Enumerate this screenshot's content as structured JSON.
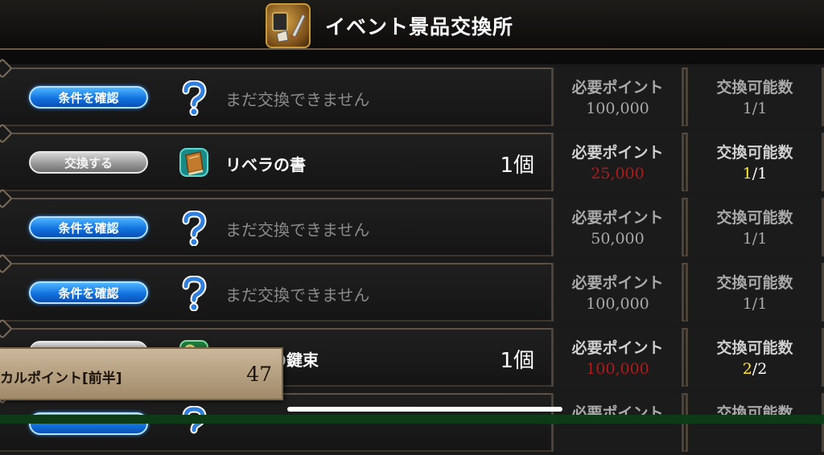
{
  "header": {
    "title": "イベント景品交換所",
    "emblem_icon": "sword-shield-emblem-icon"
  },
  "columns": {
    "points_label": "必要ポイント",
    "count_label": "交換可能数"
  },
  "rows": [
    {
      "button_label": "条件を確認",
      "button_style": "blue",
      "icon": "question-mark-icon",
      "status_text": "まだ交換できません",
      "required_points": "100,000",
      "count_current": "1",
      "count_sep": "/",
      "count_total": "1"
    },
    {
      "button_label": "交換する",
      "button_style": "gray",
      "icon": "book-icon",
      "item_name": "リベラの書",
      "quantity": "1個",
      "required_points": "25,000",
      "count_current": "1",
      "count_sep": "/",
      "count_total": "1"
    },
    {
      "button_label": "条件を確認",
      "button_style": "blue",
      "icon": "question-mark-icon",
      "status_text": "まだ交換できません",
      "required_points": "50,000",
      "count_current": "1",
      "count_sep": "/",
      "count_total": "1"
    },
    {
      "button_label": "条件を確認",
      "button_style": "blue",
      "icon": "question-mark-icon",
      "status_text": "まだ交換できません",
      "required_points": "100,000",
      "count_current": "1",
      "count_sep": "/",
      "count_total": "1"
    },
    {
      "button_style": "gray",
      "icon": "key-bundle-icon",
      "item_name": "の鍵束",
      "quantity": "1個",
      "required_points": "100,000",
      "count_current": "2",
      "count_sep": "/",
      "count_total": "2"
    },
    {
      "button_style": "blue",
      "icon": "question-mark-icon",
      "required_points": "",
      "count_total": ""
    }
  ],
  "points_popup": {
    "label": "カルポイント[前半]",
    "value": "47"
  },
  "colors": {
    "accent_blue": "#1273e0",
    "points_red": "#b11a1a",
    "count_yellow": "#ffe640",
    "frame_brown": "#5e5146"
  }
}
